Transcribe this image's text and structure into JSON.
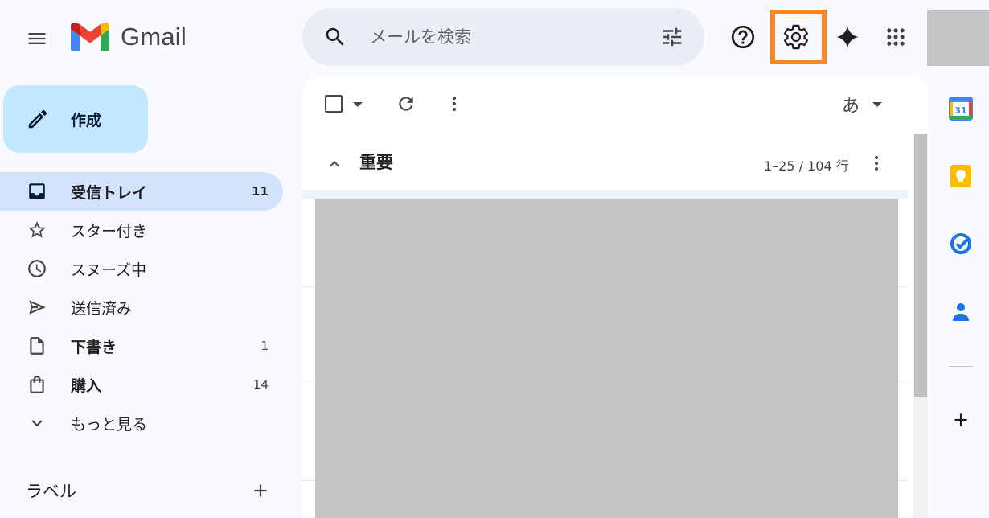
{
  "header": {
    "app_name": "Gmail",
    "search": {
      "placeholder": "メールを検索",
      "value": ""
    }
  },
  "sidebar": {
    "compose_label": "作成",
    "items": [
      {
        "label": "受信トレイ",
        "count": "11",
        "icon": "inbox-icon",
        "active": true,
        "bold": true
      },
      {
        "label": "スター付き",
        "count": "",
        "icon": "star-icon",
        "active": false,
        "bold": false
      },
      {
        "label": "スヌーズ中",
        "count": "",
        "icon": "clock-icon",
        "active": false,
        "bold": false
      },
      {
        "label": "送信済み",
        "count": "",
        "icon": "send-icon",
        "active": false,
        "bold": false
      },
      {
        "label": "下書き",
        "count": "1",
        "icon": "draft-icon",
        "active": false,
        "bold": true
      },
      {
        "label": "購入",
        "count": "14",
        "icon": "shopping-bag-icon",
        "active": false,
        "bold": true
      },
      {
        "label": "もっと見る",
        "count": "",
        "icon": "chevron-down-icon",
        "active": false,
        "bold": false
      }
    ],
    "labels_title": "ラベル"
  },
  "toolbar": {
    "input_tools_label": "あ"
  },
  "section": {
    "title": "重要",
    "pagination": "1–25 / 104 行"
  },
  "side_panel": {
    "calendar_day": "31"
  },
  "colors": {
    "compose_bg": "#c2e7ff",
    "active_nav_bg": "#d3e3fd",
    "search_bg": "#e9eef6",
    "settings_highlight": "#f5882a"
  }
}
